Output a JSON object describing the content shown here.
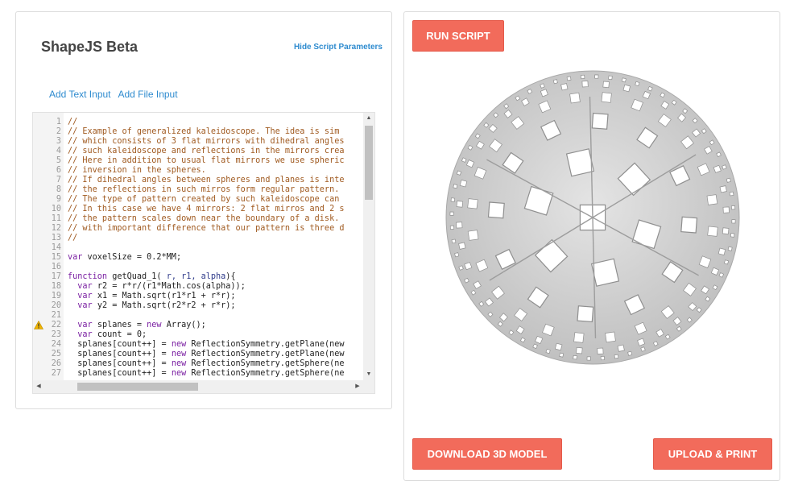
{
  "app": {
    "title": "ShapeJS Beta"
  },
  "params": {
    "hide_label": "Hide Script Parameters",
    "add_text_input": "Add Text Input",
    "add_file_input": "Add File Input"
  },
  "editor": {
    "lines": [
      {
        "n": "1",
        "t": [
          [
            "c",
            "//"
          ]
        ]
      },
      {
        "n": "2",
        "t": [
          [
            "c",
            "// Example of generalized kaleidoscope. The idea is sim"
          ]
        ]
      },
      {
        "n": "3",
        "t": [
          [
            "c",
            "// which consists of 3 flat mirrors with dihedral angles"
          ]
        ]
      },
      {
        "n": "4",
        "t": [
          [
            "c",
            "// such kaleidoscope and reflections in the mirrors crea"
          ]
        ]
      },
      {
        "n": "5",
        "t": [
          [
            "c",
            "// Here in addition to usual flat mirrors we use spheric"
          ]
        ]
      },
      {
        "n": "6",
        "t": [
          [
            "c",
            "// inversion in the spheres."
          ]
        ]
      },
      {
        "n": "7",
        "t": [
          [
            "c",
            "// If dihedral angles between spheres and planes is inte"
          ]
        ]
      },
      {
        "n": "8",
        "t": [
          [
            "c",
            "// the reflections in such mirros form regular pattern."
          ]
        ]
      },
      {
        "n": "9",
        "t": [
          [
            "c",
            "// The type of pattern created by such kaleidoscope can"
          ]
        ]
      },
      {
        "n": "10",
        "t": [
          [
            "c",
            "// In this case we have 4 mirrors: 2 flat mirros and 2 s"
          ]
        ]
      },
      {
        "n": "11",
        "t": [
          [
            "c",
            "// the pattern scales down near the boundary of a disk."
          ]
        ]
      },
      {
        "n": "12",
        "t": [
          [
            "c",
            "// with important difference that our pattern is three d"
          ]
        ]
      },
      {
        "n": "13",
        "t": [
          [
            "c",
            "//"
          ]
        ]
      },
      {
        "n": "14",
        "t": []
      },
      {
        "n": "15",
        "t": [
          [
            "k",
            "var"
          ],
          [
            "p",
            " voxelSize = 0.2*MM;"
          ]
        ]
      },
      {
        "n": "16",
        "t": []
      },
      {
        "n": "17",
        "t": [
          [
            "k",
            "function"
          ],
          [
            "p",
            " getQuad_1( "
          ],
          [
            "f",
            "r, r1, alpha"
          ],
          [
            "p",
            ")"
          ],
          [
            "p",
            "{"
          ]
        ]
      },
      {
        "n": "18",
        "t": [
          [
            "p",
            "  "
          ],
          [
            "k",
            "var"
          ],
          [
            "p",
            " r2 = r*r/(r1*Math.cos(alpha));"
          ]
        ]
      },
      {
        "n": "19",
        "t": [
          [
            "p",
            "  "
          ],
          [
            "k",
            "var"
          ],
          [
            "p",
            " x1 = Math.sqrt(r1*r1 + r*r);"
          ]
        ]
      },
      {
        "n": "20",
        "t": [
          [
            "p",
            "  "
          ],
          [
            "k",
            "var"
          ],
          [
            "p",
            " y2 = Math.sqrt(r2*r2 + r*r);"
          ]
        ]
      },
      {
        "n": "21",
        "t": []
      },
      {
        "n": "22",
        "t": [
          [
            "p",
            "  "
          ],
          [
            "k",
            "var"
          ],
          [
            "p",
            " splanes = "
          ],
          [
            "k",
            "new"
          ],
          [
            "p",
            " Array();"
          ]
        ],
        "warn": true
      },
      {
        "n": "23",
        "t": [
          [
            "p",
            "  "
          ],
          [
            "k",
            "var"
          ],
          [
            "p",
            " count = 0;"
          ]
        ]
      },
      {
        "n": "24",
        "t": [
          [
            "p",
            "  splanes[count++] = "
          ],
          [
            "k",
            "new"
          ],
          [
            "p",
            " ReflectionSymmetry.getPlane(new"
          ]
        ]
      },
      {
        "n": "25",
        "t": [
          [
            "p",
            "  splanes[count++] = "
          ],
          [
            "k",
            "new"
          ],
          [
            "p",
            " ReflectionSymmetry.getPlane(new"
          ]
        ]
      },
      {
        "n": "26",
        "t": [
          [
            "p",
            "  splanes[count++] = "
          ],
          [
            "k",
            "new"
          ],
          [
            "p",
            " ReflectionSymmetry.getSphere(ne"
          ]
        ]
      },
      {
        "n": "27",
        "t": [
          [
            "p",
            "  splanes[count++] = "
          ],
          [
            "k",
            "new"
          ],
          [
            "p",
            " ReflectionSymmetry.getSphere(ne"
          ]
        ]
      }
    ]
  },
  "actions": {
    "run": "RUN SCRIPT",
    "download": "DOWNLOAD 3D MODEL",
    "upload": "UPLOAD & PRINT"
  },
  "colors": {
    "accent": "#f26b5b",
    "link": "#2e8bcf",
    "model": "#cfcfcf"
  },
  "icons": {
    "warning": "warning-icon",
    "scroll_up": "arrow-up-icon",
    "scroll_down": "arrow-down-icon",
    "scroll_left": "arrow-left-icon",
    "scroll_right": "arrow-right-icon"
  }
}
